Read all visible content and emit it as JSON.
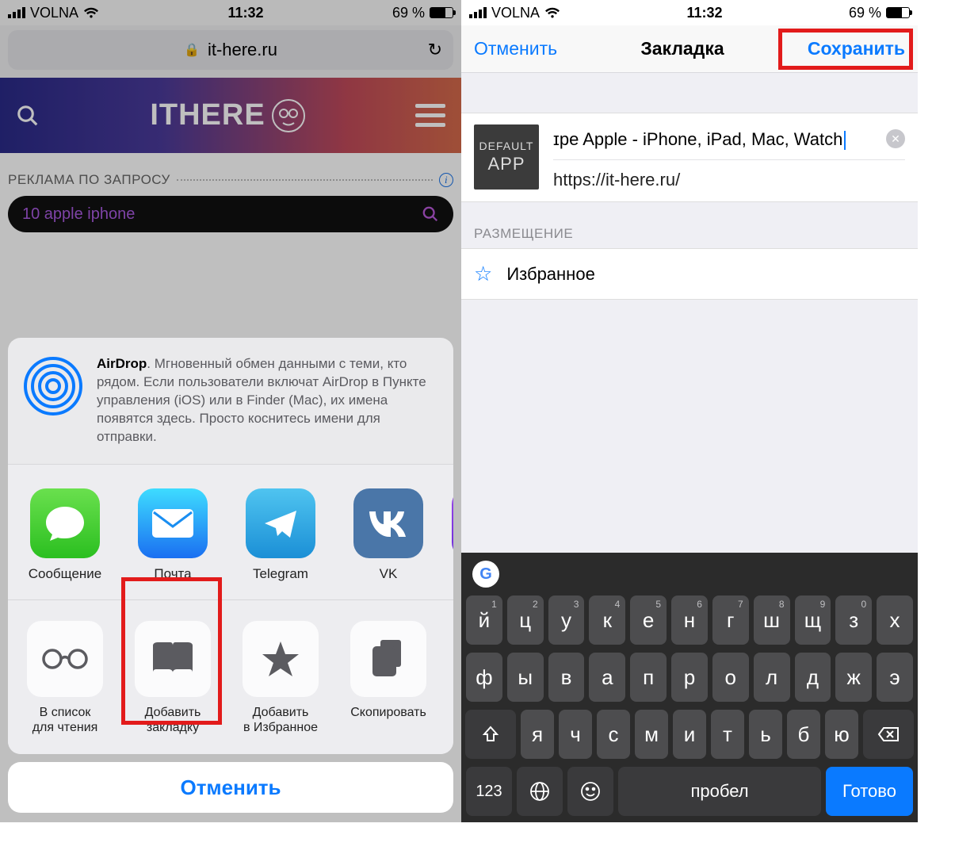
{
  "status": {
    "carrier": "VOLNA",
    "time": "11:32",
    "battery_pct": "69 %"
  },
  "left": {
    "url_domain": "it-here.ru",
    "site_logo": "ITHERE",
    "ad_label": "РЕКЛАМА ПО ЗАПРОСУ",
    "ad_query": "10 apple iphone",
    "airdrop_title": "AirDrop",
    "airdrop_body": ". Мгновенный обмен данными с теми, кто рядом. Если пользователи включат AirDrop в Пункте управления (iOS) или в Finder (Mac), их имена появятся здесь. Просто коснитесь имени для отправки.",
    "apps": [
      {
        "label": "Сообщение"
      },
      {
        "label": "Почта"
      },
      {
        "label": "Telegram"
      },
      {
        "label": "VK"
      }
    ],
    "actions": [
      {
        "label": "В список\nдля чтения"
      },
      {
        "label": "Добавить\nзакладку"
      },
      {
        "label": "Добавить\nв Избранное"
      },
      {
        "label": "Скопировать"
      }
    ],
    "cancel": "Отменить"
  },
  "right": {
    "nav_cancel": "Отменить",
    "nav_title": "Закладка",
    "nav_save": "Сохранить",
    "thumb_line1": "DEFAULT",
    "thumb_line2": "APP",
    "title_value": "ɪpe Apple - iPhone, iPad, Mac, Watch",
    "url_value": "https://it-here.ru/",
    "section": "РАЗМЕЩЕНИЕ",
    "location": "Избранное",
    "keyboard": {
      "row1": [
        {
          "c": "й",
          "h": "1"
        },
        {
          "c": "ц",
          "h": "2"
        },
        {
          "c": "у",
          "h": "3"
        },
        {
          "c": "к",
          "h": "4"
        },
        {
          "c": "е",
          "h": "5"
        },
        {
          "c": "н",
          "h": "6"
        },
        {
          "c": "г",
          "h": "7"
        },
        {
          "c": "ш",
          "h": "8"
        },
        {
          "c": "щ",
          "h": "9"
        },
        {
          "c": "з",
          "h": "0"
        },
        {
          "c": "х",
          "h": ""
        }
      ],
      "row2": [
        {
          "c": "ф"
        },
        {
          "c": "ы"
        },
        {
          "c": "в"
        },
        {
          "c": "а"
        },
        {
          "c": "п"
        },
        {
          "c": "р"
        },
        {
          "c": "о"
        },
        {
          "c": "л"
        },
        {
          "c": "д"
        },
        {
          "c": "ж"
        },
        {
          "c": "э"
        }
      ],
      "row3": [
        {
          "c": "я"
        },
        {
          "c": "ч"
        },
        {
          "c": "с"
        },
        {
          "c": "м"
        },
        {
          "c": "и"
        },
        {
          "c": "т"
        },
        {
          "c": "ь"
        },
        {
          "c": "б"
        },
        {
          "c": "ю"
        }
      ],
      "sym": "123",
      "space": "пробел",
      "done": "Готово"
    }
  }
}
